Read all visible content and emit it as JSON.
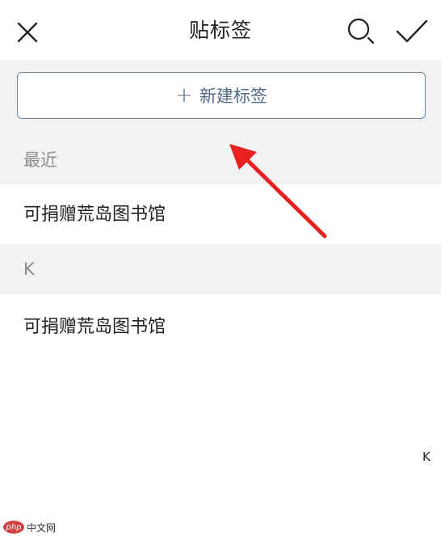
{
  "header": {
    "title": "贴标签",
    "close_icon": "close-icon",
    "search_icon": "search-icon",
    "confirm_icon": "checkmark-icon"
  },
  "new_tag": {
    "plus_glyph": "+",
    "label": "新建标签"
  },
  "sections": {
    "recent": {
      "header": "最近",
      "items": [
        "可捐赠荒岛图书馆"
      ]
    },
    "k": {
      "header": "K",
      "items": [
        "可捐赠荒岛图书馆"
      ]
    }
  },
  "index": {
    "letter": "K"
  },
  "watermark": {
    "logo": "php",
    "text": "中文网"
  },
  "colors": {
    "accent": "#506a87",
    "arrow": "#e8201f",
    "section_bg": "#f2f2f2",
    "section_text": "#8c8c8c"
  }
}
